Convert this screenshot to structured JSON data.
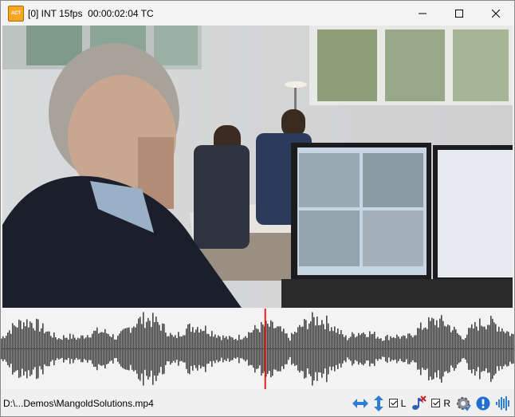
{
  "window": {
    "title": "[0] INT 15fps  00:00:02:04 TC",
    "app_icon_text": "ACT",
    "controls": [
      "minimize-icon",
      "maximize-icon",
      "close-icon"
    ]
  },
  "video": {
    "description_icon": "video-frame"
  },
  "waveform": {
    "waveform_color": "#464646",
    "playhead_color": "#e02020",
    "playhead_position": 0.515
  },
  "status": {
    "file_path": "D:\\...Demos\\MangoldSolutions.mp4",
    "left_channel_label": "L",
    "right_channel_label": "R",
    "left_checked": true,
    "right_checked": true,
    "icons": [
      "horizontal-zoom-icon",
      "vertical-zoom-icon",
      "audio-settings-icon",
      "settings-gear-icon",
      "info-icon",
      "waveform-icon"
    ]
  }
}
